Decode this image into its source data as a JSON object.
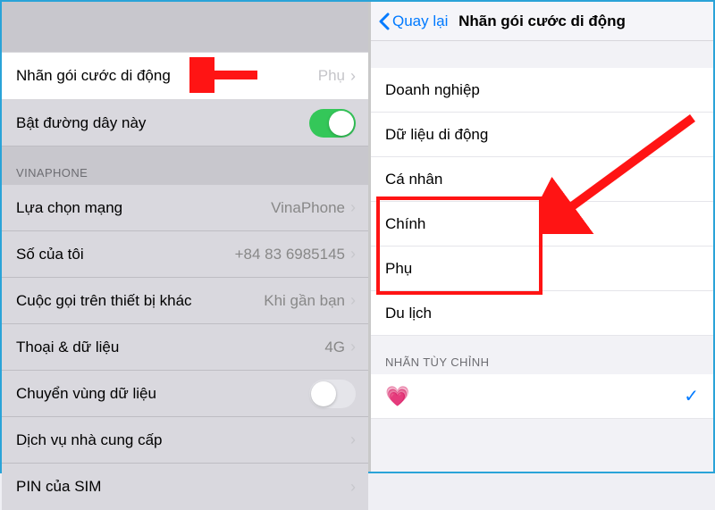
{
  "left": {
    "cellular_label_row": {
      "label": "Nhãn gói cước di động",
      "value": "Phụ"
    },
    "enable_line": {
      "label": "Bật đường dây này"
    },
    "section_vinaphone": "VINAPHONE",
    "network_selection": {
      "label": "Lựa chọn mạng",
      "value": "VinaPhone"
    },
    "my_number": {
      "label": "Số của tôi",
      "value": "+84 83 6985145"
    },
    "calls_on_other": {
      "label": "Cuộc gọi trên thiết bị khác",
      "value": "Khi gần bạn"
    },
    "voice_data": {
      "label": "Thoại & dữ liệu",
      "value": "4G"
    },
    "data_roaming": {
      "label": "Chuyển vùng dữ liệu"
    },
    "carrier_services": {
      "label": "Dịch vụ nhà cung cấp"
    },
    "sim_pin": {
      "label": "PIN của SIM"
    }
  },
  "right": {
    "back": "Quay lại",
    "title": "Nhãn gói cước di động",
    "options": {
      "business": "Doanh nghiệp",
      "cellular_data": "Dữ liệu di động",
      "personal": "Cá nhân",
      "primary": "Chính",
      "secondary": "Phụ",
      "travel": "Du lịch"
    },
    "custom_section": "NHÃN TÙY CHỈNH",
    "custom_heart": "💗"
  }
}
